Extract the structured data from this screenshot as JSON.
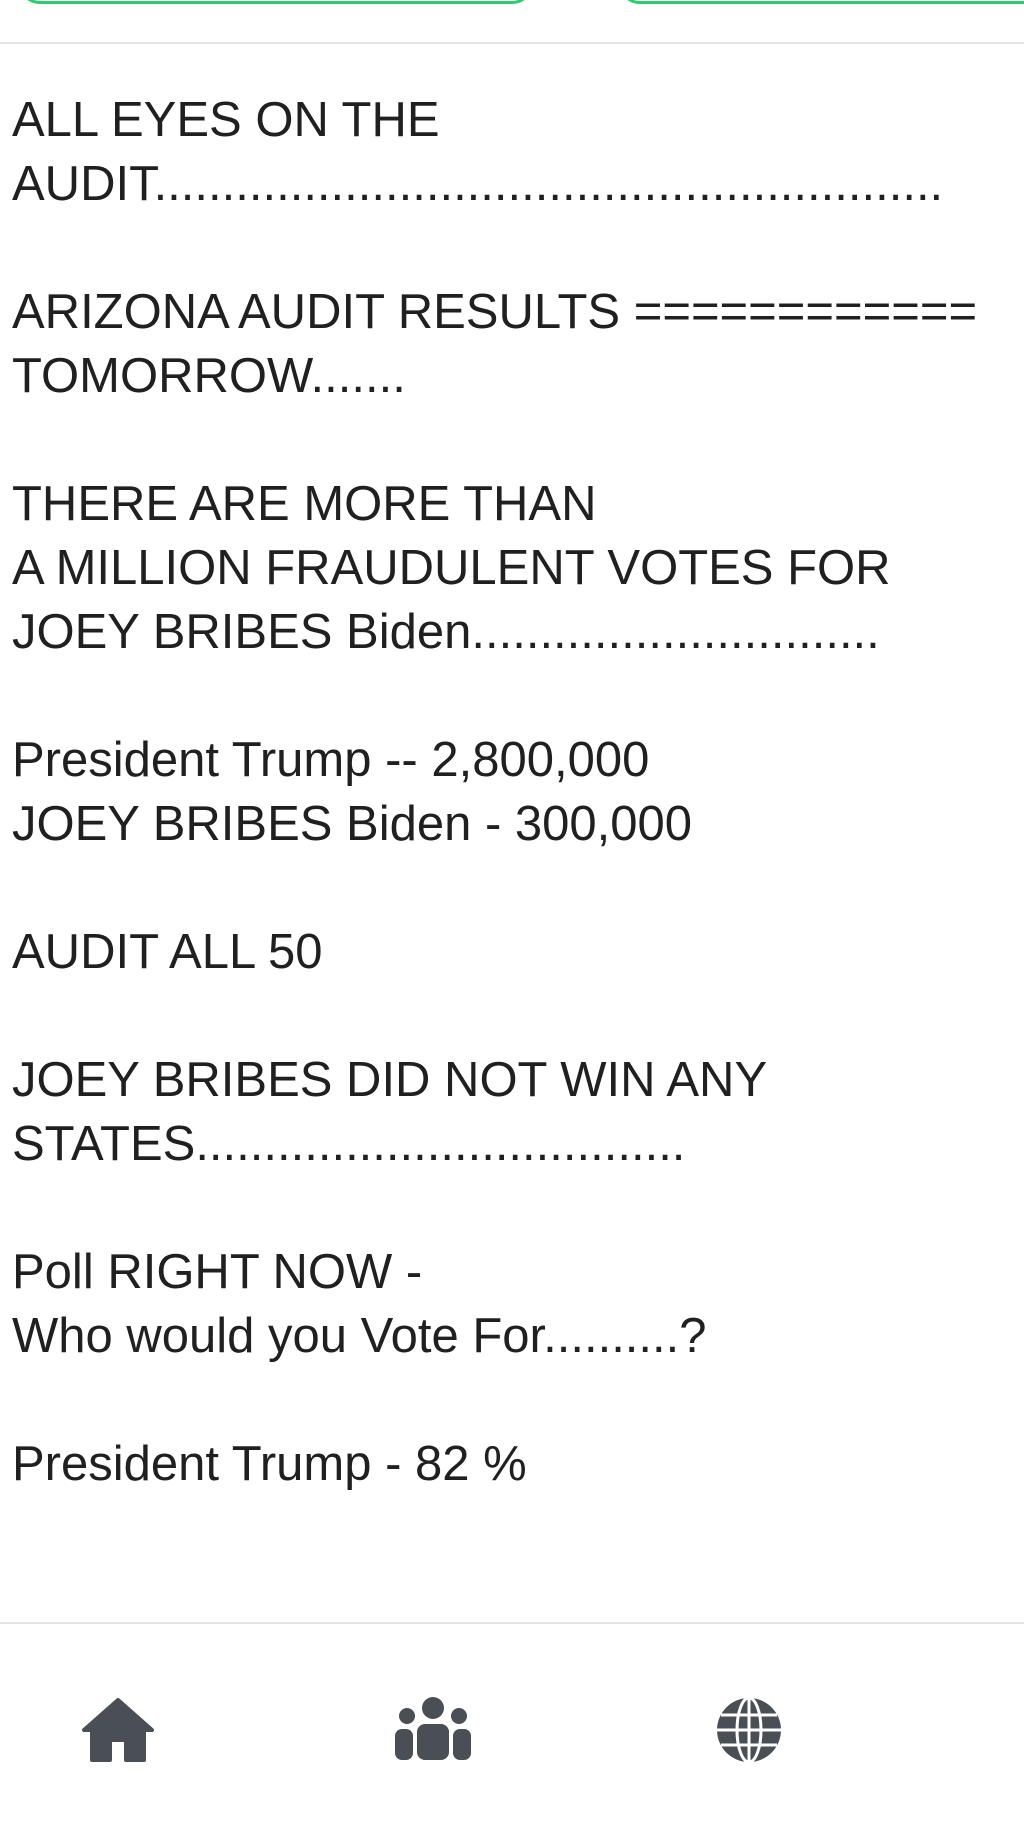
{
  "post": {
    "lines": [
      "ALL EYES ON THE",
      "AUDIT..........................................................",
      "",
      "ARIZONA AUDIT RESULTS ============",
      "TOMORROW.......",
      "",
      "THERE ARE MORE THAN",
      "A MILLION FRAUDULENT VOTES FOR",
      "JOEY BRIBES Biden..............................",
      "",
      "President Trump -- 2,800,000",
      "JOEY BRIBES Biden - 300,000",
      "",
      "AUDIT ALL 50",
      "",
      "JOEY BRIBES DID NOT WIN ANY",
      "STATES....................................",
      "",
      "Poll RIGHT NOW -",
      "Who would you Vote For..........?",
      "",
      "President Trump - 82 %"
    ]
  },
  "nav": {
    "items": [
      {
        "icon": "home-icon"
      },
      {
        "icon": "users-icon"
      },
      {
        "icon": "globe-icon"
      }
    ]
  },
  "colors": {
    "accent_green": "#2ecc71",
    "icon_gray": "#4a4f55",
    "text": "#202020",
    "divider": "#e3e3e3"
  }
}
